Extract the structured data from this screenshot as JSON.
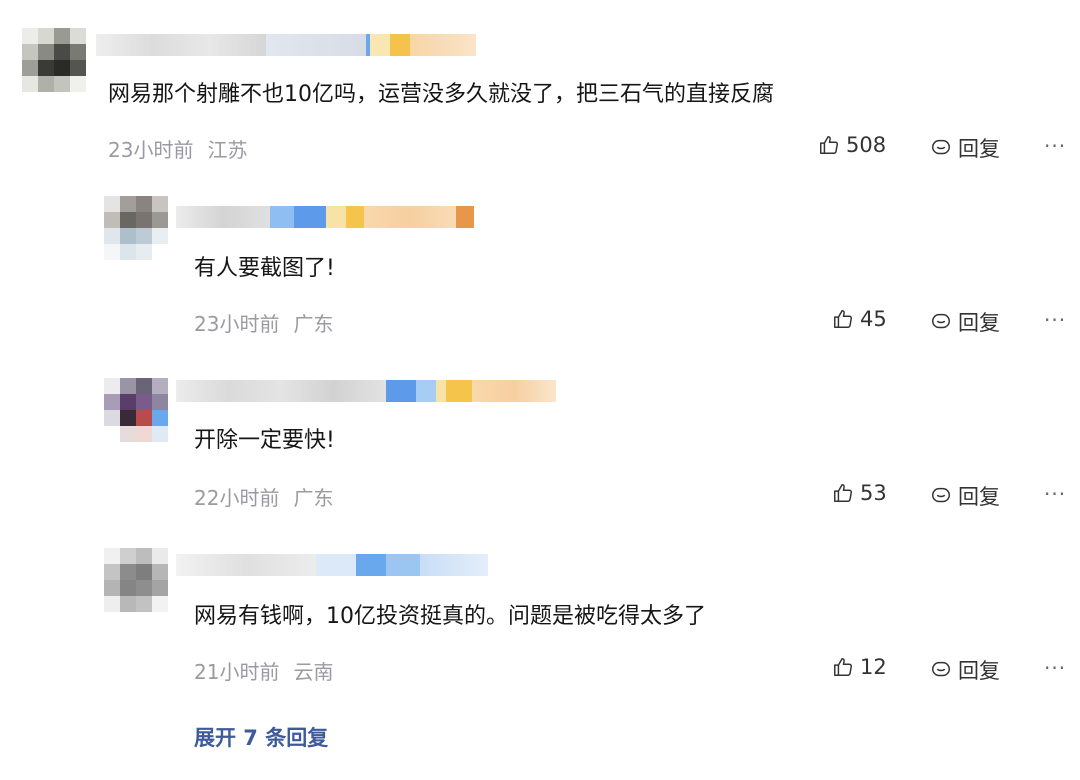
{
  "comments": [
    {
      "text": "网易那个射雕不也10亿吗，运营没多久就没了，把三石气的直接反腐",
      "time": "23小时前",
      "location": "江苏",
      "likes": "508",
      "reply_label": "回复",
      "more_label": "···"
    },
    {
      "text": "有人要截图了!",
      "time": "23小时前",
      "location": "广东",
      "likes": "45",
      "reply_label": "回复",
      "more_label": "···"
    },
    {
      "text": "开除一定要快!",
      "time": "22小时前",
      "location": "广东",
      "likes": "53",
      "reply_label": "回复",
      "more_label": "···"
    },
    {
      "text": "网易有钱啊，10亿投资挺真的。问题是被吃得太多了",
      "time": "21小时前",
      "location": "云南",
      "likes": "12",
      "reply_label": "回复",
      "more_label": "···"
    }
  ],
  "expand_label": "展开 7 条回复",
  "colors": {
    "accent_link": "#3e5a9a",
    "meta_gray": "#9a9aa2"
  },
  "icons": {
    "like": "thumbs-up-icon",
    "reply": "speech-bubble-icon",
    "more": "more-dots-icon"
  }
}
